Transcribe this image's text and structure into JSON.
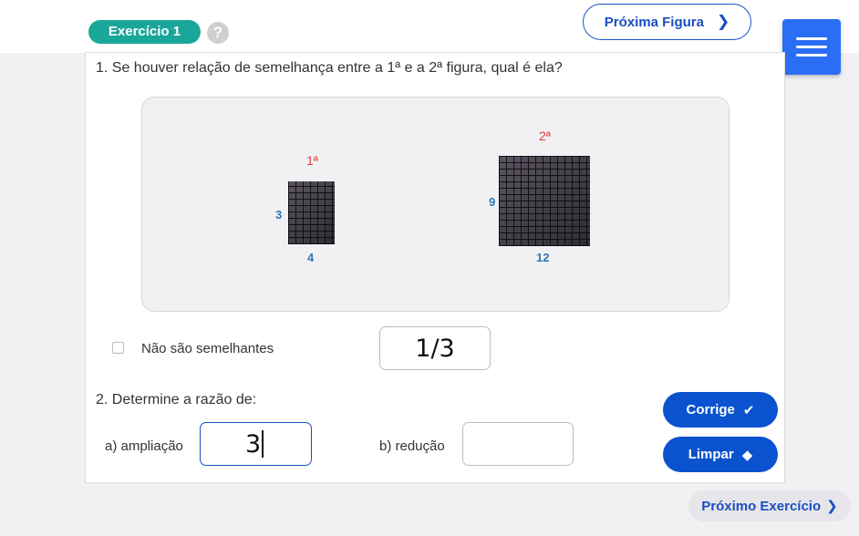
{
  "header": {
    "exercise_badge": "Exercício 1",
    "help_icon_glyph": "?",
    "next_figure_label": "Próxima Figura",
    "chevron_glyph": "❯"
  },
  "question1": {
    "text": "1. Se houver relação de semelhança entre a 1ª e a 2ª figura, qual é ela?",
    "figure1": {
      "label": "1ª",
      "side": "3",
      "bottom": "4"
    },
    "figure2": {
      "label": "2ª",
      "side": "9",
      "bottom": "12"
    },
    "not_similar_label": "Não são semelhantes",
    "not_similar_checked": false,
    "answer_value": "1/3"
  },
  "question2": {
    "text": "2. Determine a razão de:",
    "a_label": "a) ampliação",
    "a_value": "3",
    "b_label": "b) redução",
    "b_value": ""
  },
  "buttons": {
    "corrige_label": "Corrige",
    "corrige_icon": "✔",
    "limpar_label": "Limpar",
    "limpar_icon": "◆",
    "next_exercise_label": "Próximo Exercício",
    "next_exercise_icon": "❯"
  },
  "colors": {
    "badge": "#1aa79a",
    "primary_blue": "#0b52cf",
    "menu_blue": "#2a6ef5",
    "figure_label_red": "#e53935",
    "dimension_blue": "#2d77b3"
  },
  "icons": {
    "menu": "hamburger-menu-icon",
    "help": "question-circle-icon",
    "corrige": "checkmark-icon",
    "limpar": "eraser-icon"
  }
}
